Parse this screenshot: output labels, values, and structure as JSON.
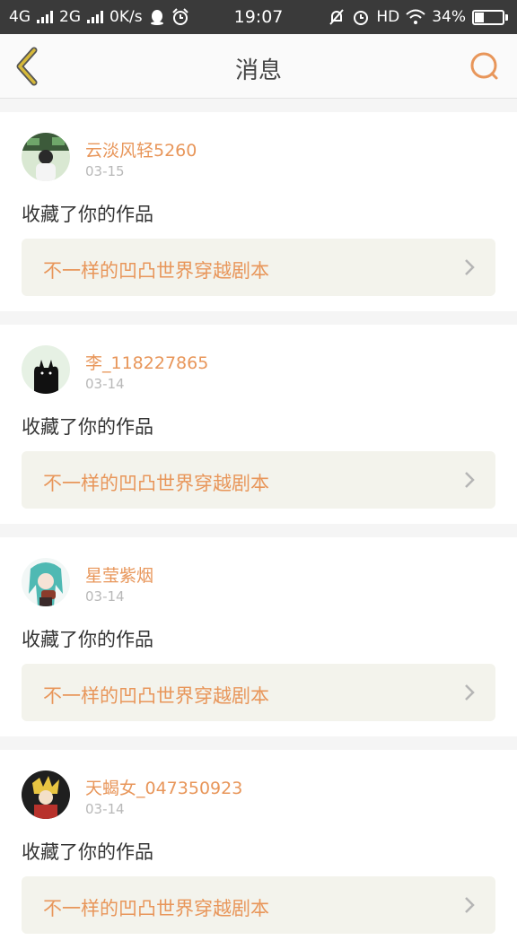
{
  "status_bar": {
    "net1": "4G",
    "net2": "2G",
    "speed": "0K/s",
    "time": "19:07",
    "hd": "HD",
    "battery_text": "34%",
    "battery_level": 0.34
  },
  "header": {
    "title": "消息"
  },
  "colors": {
    "accent": "#e8965a",
    "back_icon": "#d6b93a"
  },
  "messages": [
    {
      "username": "云淡风轻5260",
      "date": "03-15",
      "action": "收藏了你的作品",
      "work_title": "不一样的凹凸世界穿越剧本"
    },
    {
      "username": "李_118227865",
      "date": "03-14",
      "action": "收藏了你的作品",
      "work_title": "不一样的凹凸世界穿越剧本"
    },
    {
      "username": "星莹紫烟",
      "date": "03-14",
      "action": "收藏了你的作品",
      "work_title": "不一样的凹凸世界穿越剧本"
    },
    {
      "username": "天蝎女_047350923",
      "date": "03-14",
      "action": "收藏了你的作品",
      "work_title": "不一样的凹凸世界穿越剧本"
    }
  ]
}
